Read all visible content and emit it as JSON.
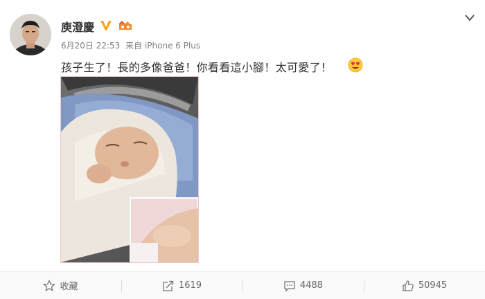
{
  "post": {
    "author": "庾澄慶",
    "date": "6月20日 22:53",
    "source": "来自 iPhone 6 Plus",
    "text": "孩子生了！長的多像爸爸！你看看這小腳！太可愛了！"
  },
  "actions": {
    "favorite": "收藏",
    "reposts": "1619",
    "comments": "4488",
    "likes": "50945"
  },
  "colors": {
    "verified": "#f5a623",
    "text": "#333333",
    "muted": "#808080"
  }
}
